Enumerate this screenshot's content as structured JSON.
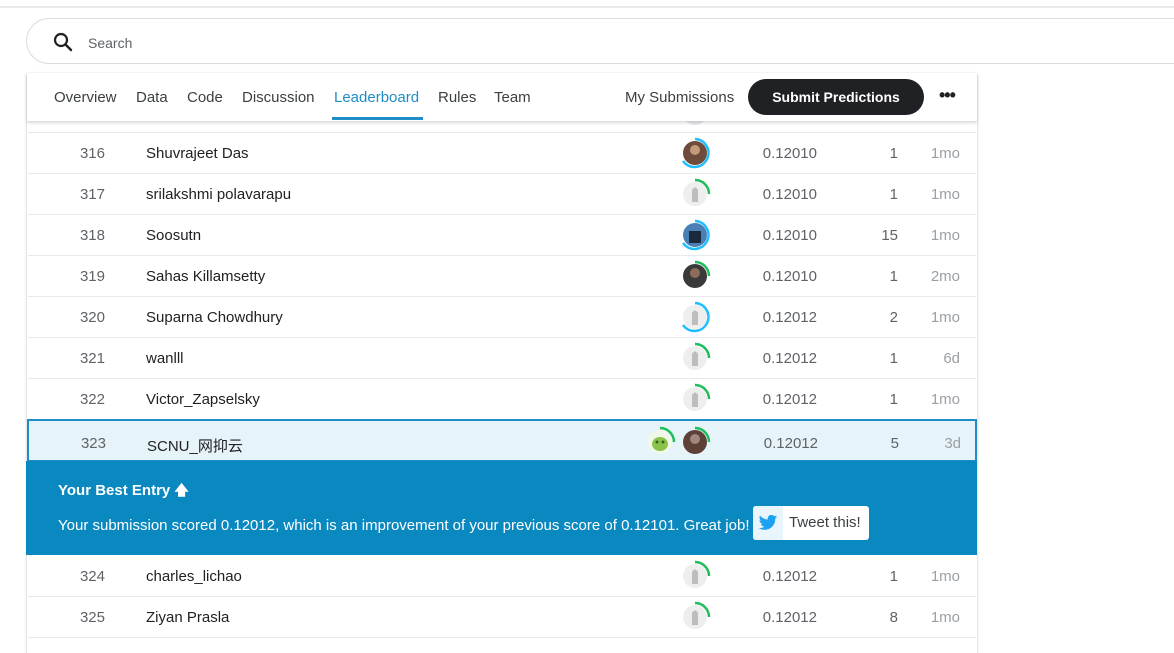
{
  "search": {
    "placeholder": "Search"
  },
  "tabs": [
    {
      "label": "Overview"
    },
    {
      "label": "Data"
    },
    {
      "label": "Code"
    },
    {
      "label": "Discussion"
    },
    {
      "label": "Leaderboard",
      "active": true
    },
    {
      "label": "Rules"
    },
    {
      "label": "Team"
    }
  ],
  "actions": {
    "my_submissions": "My Submissions",
    "submit": "Submit Predictions",
    "more": "•••"
  },
  "rows": [
    {
      "rank": "316",
      "name": "Shuvrajeet Das",
      "score": "0.12010",
      "entries": "1",
      "last": "1mo"
    },
    {
      "rank": "317",
      "name": "srilakshmi polavarapu",
      "score": "0.12010",
      "entries": "1",
      "last": "1mo"
    },
    {
      "rank": "318",
      "name": "Soosutn",
      "score": "0.12010",
      "entries": "15",
      "last": "1mo"
    },
    {
      "rank": "319",
      "name": "Sahas Killamsetty",
      "score": "0.12010",
      "entries": "1",
      "last": "2mo"
    },
    {
      "rank": "320",
      "name": "Suparna Chowdhury",
      "score": "0.12012",
      "entries": "2",
      "last": "1mo"
    },
    {
      "rank": "321",
      "name": "wanlll",
      "score": "0.12012",
      "entries": "1",
      "last": "6d"
    },
    {
      "rank": "322",
      "name": "Victor_Zapselsky",
      "score": "0.12012",
      "entries": "1",
      "last": "1mo"
    },
    {
      "rank": "323",
      "name": "SCNU_网抑云",
      "score": "0.12012",
      "entries": "5",
      "last": "3d"
    },
    {
      "rank": "324",
      "name": "charles_lichao",
      "score": "0.12012",
      "entries": "1",
      "last": "1mo"
    },
    {
      "rank": "325",
      "name": "Ziyan Prasla",
      "score": "0.12012",
      "entries": "8",
      "last": "1mo"
    }
  ],
  "best_entry": {
    "title": "Your Best Entry",
    "arrow": "🡅",
    "message": "Your submission scored 0.12012, which is an improvement of your previous score of 0.12101. Great job!",
    "tweet_label": "Tweet this!"
  },
  "colors": {
    "accent": "#1f8ec8",
    "banner": "#0a88c0",
    "tier_green": "#20beff",
    "progress": "#1ebe5a"
  }
}
